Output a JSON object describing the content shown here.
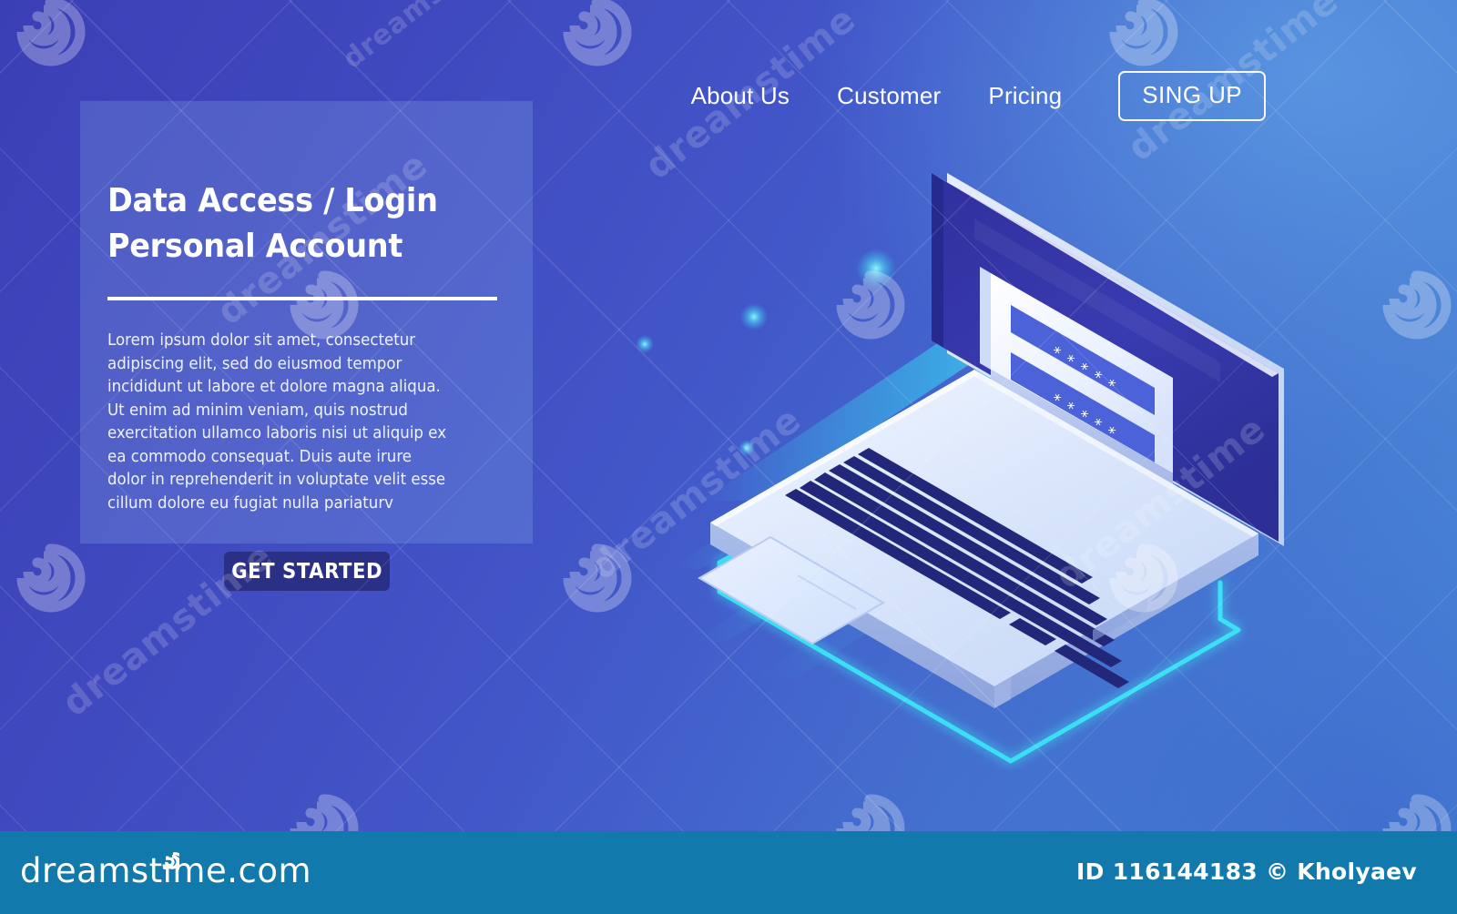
{
  "theme": {
    "bg_indigo": "#3b3fb6",
    "bg_blue": "#4a8ad8",
    "panel_overlay": "rgba(148,190,240,0.22)",
    "accent_cyan": "#3ce3f5",
    "button_navy": "#2a3086",
    "screen_navy": "#2e2f9e",
    "keyboard_key": "#23277a",
    "card_white": "#f3f7ff",
    "input_blue": "#4b62d8",
    "footer_teal": "#1179ab",
    "text_white": "#ffffff"
  },
  "nav": {
    "items": [
      {
        "label": "About Us",
        "name": "nav-link-about-us"
      },
      {
        "label": "Customer",
        "name": "nav-link-customer"
      },
      {
        "label": "Pricing",
        "name": "nav-link-pricing"
      }
    ],
    "cta_label": "SING UP"
  },
  "hero": {
    "title": "Data Access / Login\nPersonal Account",
    "title_line_1": "Data Access / Login",
    "title_line_2": "Personal Account",
    "body": "Lorem ipsum dolor sit amet, consectetur adipiscing elit, sed do eiusmod tempor incididunt ut labore et dolore magna aliqua. Ut enim ad minim veniam, quis nostrud exercitation ullamco laboris nisi ut aliquip ex ea commodo consequat. Duis aute irure dolor in reprehenderit in voluptate velit esse cillum dolore eu fugiat nulla pariaturv",
    "button_label": "GET STARTED"
  },
  "illustration": {
    "name": "isometric-laptop-login",
    "login_card": {
      "username_field_value": "*****",
      "password_field_value": "*****",
      "field_count": 2,
      "mask_character": "*"
    },
    "speed_streaks": 5,
    "glow_dots": 6,
    "base_outline": "cyan-isometric-frame"
  },
  "watermark": {
    "word": "dreamstime",
    "icon": "spiral-icon",
    "pattern": "diagonal-crosshatch"
  },
  "footer": {
    "site_label": "dreamstime.com",
    "credit": "ID 116144183 © Kholyaev",
    "image_id": "116144183",
    "author": "Kholyaev"
  }
}
